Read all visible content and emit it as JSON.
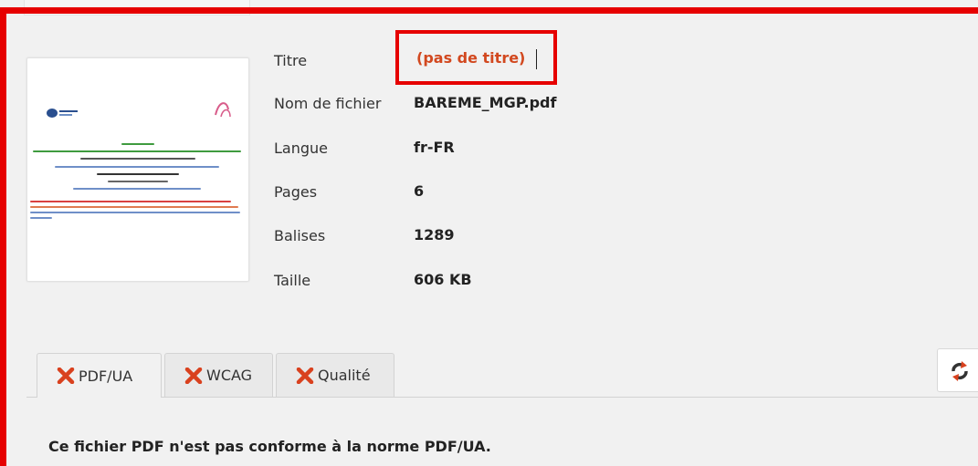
{
  "metadata": {
    "title_label": "Titre",
    "title_value": "(pas de titre)",
    "filename_label": "Nom de fichier",
    "filename_value": "BAREME_MGP.pdf",
    "language_label": "Langue",
    "language_value": "fr-FR",
    "pages_label": "Pages",
    "pages_value": "6",
    "tags_label": "Balises",
    "tags_value": "1289",
    "size_label": "Taille",
    "size_value": "606 KB"
  },
  "tabs": [
    {
      "label": "PDF/UA",
      "status_icon": "fail-x-icon",
      "active": true
    },
    {
      "label": "WCAG",
      "status_icon": "fail-x-icon",
      "active": false
    },
    {
      "label": "Qualité",
      "status_icon": "fail-x-icon",
      "active": false
    }
  ],
  "message": "Ce fichier PDF n'est pas conforme à la norme PDF/UA.",
  "colors": {
    "highlight_border": "#e60000",
    "title_value": "#d2481f",
    "fail_icon": "#d9411e"
  },
  "icons": {
    "refresh": "refresh-icon",
    "thumbnail": "pdf-preview"
  }
}
